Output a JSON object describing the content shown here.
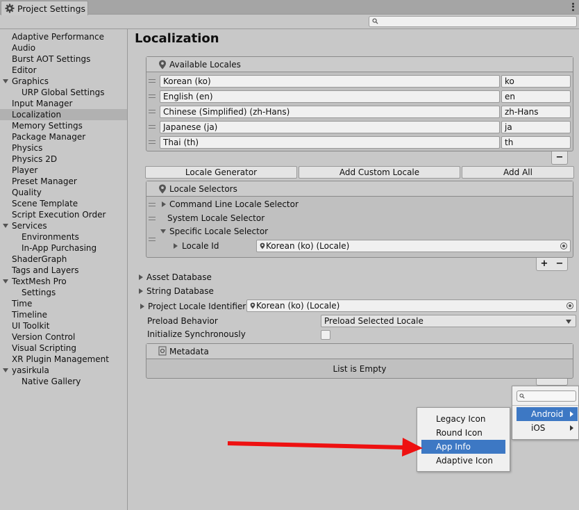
{
  "window": {
    "tab_title": "Project Settings"
  },
  "search": {
    "placeholder": ""
  },
  "sidebar": {
    "items": [
      {
        "label": "Adaptive Performance"
      },
      {
        "label": "Audio"
      },
      {
        "label": "Burst AOT Settings"
      },
      {
        "label": "Editor"
      },
      {
        "label": "Graphics"
      },
      {
        "label": "URP Global Settings"
      },
      {
        "label": "Input Manager"
      },
      {
        "label": "Localization"
      },
      {
        "label": "Memory Settings"
      },
      {
        "label": "Package Manager"
      },
      {
        "label": "Physics"
      },
      {
        "label": "Physics 2D"
      },
      {
        "label": "Player"
      },
      {
        "label": "Preset Manager"
      },
      {
        "label": "Quality"
      },
      {
        "label": "Scene Template"
      },
      {
        "label": "Script Execution Order"
      },
      {
        "label": "Services"
      },
      {
        "label": "Environments"
      },
      {
        "label": "In-App Purchasing"
      },
      {
        "label": "ShaderGraph"
      },
      {
        "label": "Tags and Layers"
      },
      {
        "label": "TextMesh Pro"
      },
      {
        "label": "Settings"
      },
      {
        "label": "Time"
      },
      {
        "label": "Timeline"
      },
      {
        "label": "UI Toolkit"
      },
      {
        "label": "Version Control"
      },
      {
        "label": "Visual Scripting"
      },
      {
        "label": "XR Plugin Management"
      },
      {
        "label": "yasirkula"
      },
      {
        "label": "Native Gallery"
      }
    ]
  },
  "main": {
    "title": "Localization",
    "available_locales": {
      "header": "Available Locales",
      "locales": [
        {
          "name": "Korean (ko)",
          "code": "ko"
        },
        {
          "name": "English (en)",
          "code": "en"
        },
        {
          "name": "Chinese (Simplified) (zh-Hans)",
          "code": "zh-Hans"
        },
        {
          "name": "Japanese (ja)",
          "code": "ja"
        },
        {
          "name": "Thai (th)",
          "code": "th"
        }
      ],
      "minus": "−"
    },
    "buttons": {
      "locale_generator": "Locale Generator",
      "add_custom_locale": "Add Custom Locale",
      "add_all": "Add All"
    },
    "locale_selectors": {
      "header": "Locale Selectors",
      "items": [
        "Command Line Locale Selector",
        "System Locale Selector",
        "Specific Locale Selector"
      ],
      "locale_id_label": "Locale Id",
      "locale_id_value": "Korean (ko) (Locale)",
      "plus": "+",
      "minus": "−"
    },
    "asset_database": "Asset Database",
    "string_database": "String Database",
    "project_locale_identifier": {
      "label": "Project Locale Identifier",
      "value": "Korean (ko) (Locale)"
    },
    "preload_behavior": {
      "label": "Preload Behavior",
      "value": "Preload Selected Locale"
    },
    "initialize_synchronously": {
      "label": "Initialize Synchronously",
      "checked": false
    },
    "metadata": {
      "header": "Metadata",
      "empty_text": "List is Empty"
    }
  },
  "platform_menu": {
    "search_placeholder": "",
    "items": [
      {
        "label": "Android",
        "highlighted": true
      },
      {
        "label": "iOS",
        "highlighted": false
      }
    ]
  },
  "android_submenu": {
    "items": [
      {
        "label": "Legacy Icon",
        "highlighted": false
      },
      {
        "label": "Round Icon",
        "highlighted": false
      },
      {
        "label": "App Info",
        "highlighted": true
      },
      {
        "label": "Adaptive Icon",
        "highlighted": false
      }
    ]
  },
  "colors": {
    "highlight": "#3d78c4",
    "arrow": "#ee1111"
  }
}
